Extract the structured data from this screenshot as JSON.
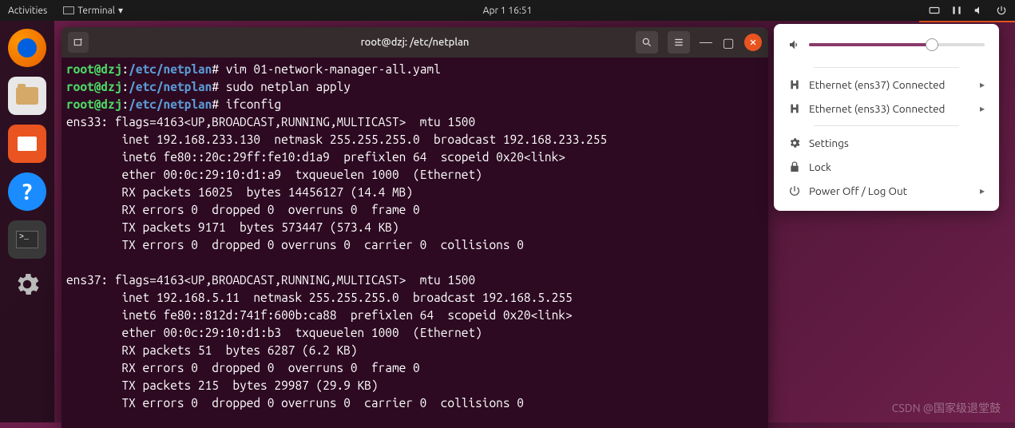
{
  "topbar": {
    "activities": "Activities",
    "app_name": "Terminal",
    "datetime": "Apr 1  16:51"
  },
  "window": {
    "title": "root@dzj: /etc/netplan"
  },
  "terminal": {
    "prompt_user": "root@dzj",
    "prompt_path": "/etc/netplan",
    "cmd1": "vim 01-network-manager-all.yaml",
    "cmd2": "sudo netplan apply",
    "cmd3": "ifconfig",
    "if1_name": "ens33: flags=4163<UP,BROADCAST,RUNNING,MULTICAST>  mtu 1500",
    "if1_l1": "        inet 192.168.233.130  netmask 255.255.255.0  broadcast 192.168.233.255",
    "if1_l2": "        inet6 fe80::20c:29ff:fe10:d1a9  prefixlen 64  scopeid 0x20<link>",
    "if1_l3": "        ether 00:0c:29:10:d1:a9  txqueuelen 1000  (Ethernet)",
    "if1_l4": "        RX packets 16025  bytes 14456127 (14.4 MB)",
    "if1_l5": "        RX errors 0  dropped 0  overruns 0  frame 0",
    "if1_l6": "        TX packets 9171  bytes 573447 (573.4 KB)",
    "if1_l7": "        TX errors 0  dropped 0 overruns 0  carrier 0  collisions 0",
    "if2_name": "ens37: flags=4163<UP,BROADCAST,RUNNING,MULTICAST>  mtu 1500",
    "if2_l1": "        inet 192.168.5.11  netmask 255.255.255.0  broadcast 192.168.5.255",
    "if2_l2": "        inet6 fe80::812d:741f:600b:ca88  prefixlen 64  scopeid 0x20<link>",
    "if2_l3": "        ether 00:0c:29:10:d1:b3  txqueuelen 1000  (Ethernet)",
    "if2_l4": "        RX packets 51  bytes 6287 (6.2 KB)",
    "if2_l5": "        RX errors 0  dropped 0  overruns 0  frame 0",
    "if2_l6": "        TX packets 215  bytes 29987 (29.9 KB)",
    "if2_l7": "        TX errors 0  dropped 0 overruns 0  carrier 0  collisions 0"
  },
  "sysmenu": {
    "volume_pct": 70,
    "eth1": "Ethernet (ens37) Connected",
    "eth2": "Ethernet (ens33) Connected",
    "settings": "Settings",
    "lock": "Lock",
    "power": "Power Off / Log Out"
  },
  "watermark": "CSDN @国家级退堂鼓"
}
